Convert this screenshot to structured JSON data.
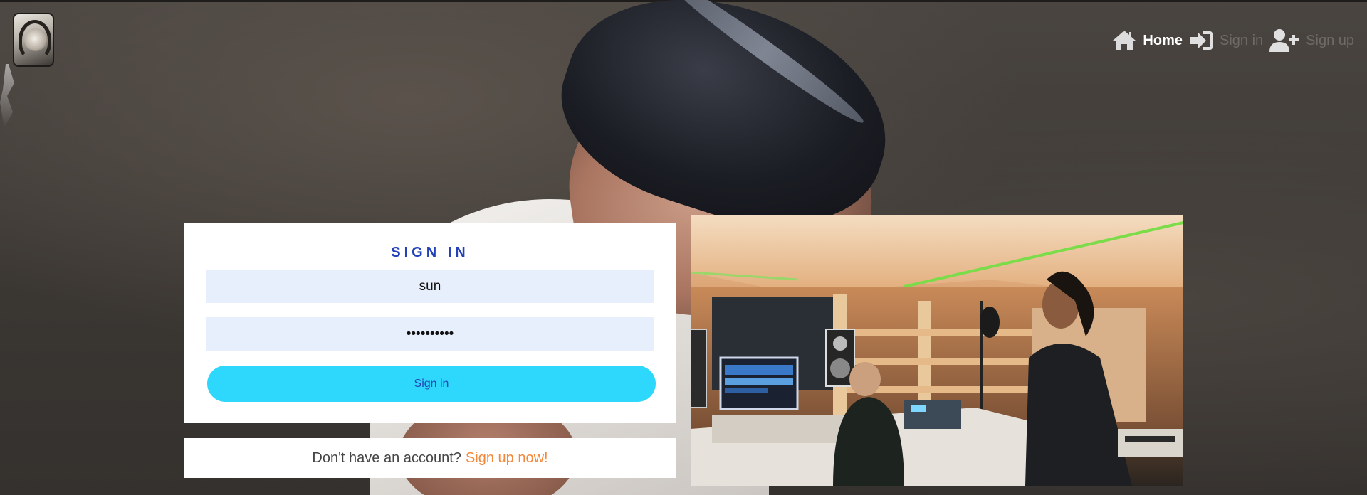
{
  "nav": {
    "home_label": "Home",
    "signin_label": "Sign in",
    "signup_label": "Sign up"
  },
  "signin": {
    "title": "SIGN IN",
    "username_value": "sun",
    "password_value": "••••••••••",
    "submit_label": "Sign in"
  },
  "signup_prompt": {
    "text": "Don't have an account?",
    "link_label": "Sign up now!"
  },
  "colors": {
    "accent_blue": "#2341b8",
    "button_cyan": "#2ed8fc",
    "input_bg": "#e8effc",
    "link_orange": "#f5873a"
  },
  "icons": {
    "home": "home-icon",
    "signin": "sign-in-icon",
    "signup": "user-plus-icon"
  }
}
